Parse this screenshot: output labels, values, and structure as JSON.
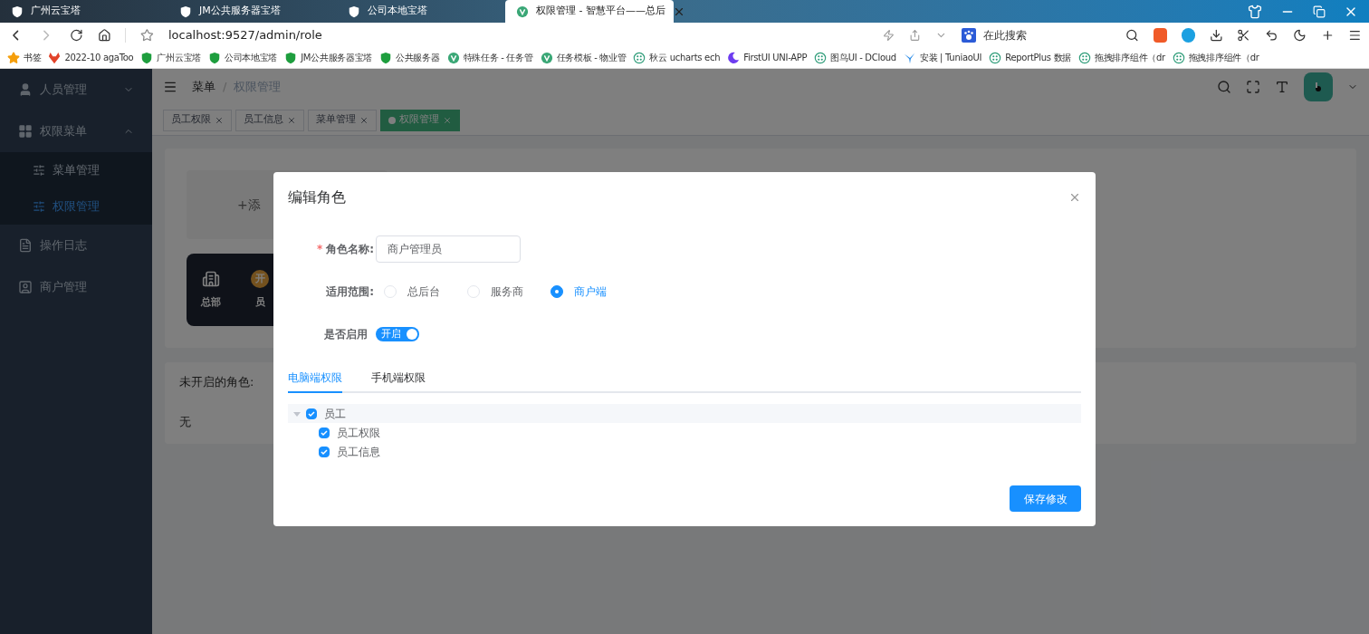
{
  "browser": {
    "tabs": [
      {
        "title": "广州云宝塔",
        "kind": "shield",
        "selected": false
      },
      {
        "title": "JM公共服务器宝塔",
        "kind": "shield",
        "selected": false
      },
      {
        "title": "公司本地宝塔",
        "kind": "shield",
        "selected": false
      },
      {
        "title": "权限管理 - 智慧平台——总后",
        "kind": "vue",
        "selected": true
      }
    ],
    "address": "localhost:9527/admin/role",
    "search_placeholder": "在此搜索",
    "bookmarks": [
      {
        "title": "书签",
        "kind": "star"
      },
      {
        "title": "2022-10 agaToo",
        "kind": "fox"
      },
      {
        "title": "广州云宝塔",
        "kind": "shield"
      },
      {
        "title": "公司本地宝塔",
        "kind": "shield"
      },
      {
        "title": "JM公共服务器宝塔",
        "kind": "shield"
      },
      {
        "title": "公共服务器",
        "kind": "shield"
      },
      {
        "title": "特殊任务 - 任务管",
        "kind": "vue"
      },
      {
        "title": "任务模板 - 物业管",
        "kind": "vue"
      },
      {
        "title": "秋云 ucharts ech",
        "kind": "globe"
      },
      {
        "title": "FirstUI UNI-APP",
        "kind": "moon"
      },
      {
        "title": "图鸟UI - DCloud",
        "kind": "globe"
      },
      {
        "title": "安装 | TuniaoUI",
        "kind": "bird"
      },
      {
        "title": "ReportPlus 数据",
        "kind": "globe"
      },
      {
        "title": "拖拽排序组件（dr",
        "kind": "globe"
      },
      {
        "title": "拖拽排序组件（dr",
        "kind": "globe"
      }
    ]
  },
  "sidebar": {
    "items": [
      {
        "label": "人员管理",
        "kind": "user",
        "expanded": false,
        "selected": false
      },
      {
        "label": "权限菜单",
        "kind": "grid",
        "expanded": true,
        "selected": false,
        "children": [
          {
            "label": "菜单管理",
            "selected": false
          },
          {
            "label": "权限管理",
            "selected": true
          }
        ]
      },
      {
        "label": "操作日志",
        "kind": "log",
        "selected": false
      },
      {
        "label": "商户管理",
        "kind": "merchant",
        "selected": false
      }
    ]
  },
  "header": {
    "breadcrumb": [
      "菜单",
      "权限管理"
    ],
    "separator": "/"
  },
  "tags": [
    {
      "label": "员工权限",
      "selected": false
    },
    {
      "label": "员工信息",
      "selected": false
    },
    {
      "label": "菜单管理",
      "selected": false
    },
    {
      "label": "权限管理",
      "selected": true
    }
  ],
  "content": {
    "add_card": "+添",
    "role_cards": [
      {
        "label": "总部",
        "kind": "building"
      },
      {
        "label": "员",
        "badge": "开",
        "kind": "badge"
      }
    ],
    "inactive": {
      "title": "未开启的角色:",
      "value": "无"
    }
  },
  "modal": {
    "title": "编辑角色",
    "name_field": {
      "label": "角色名称:",
      "required_mark": "*",
      "value": "商户管理员"
    },
    "scope": {
      "label": "适用范围:",
      "options": [
        {
          "label": "总后台",
          "selected": false
        },
        {
          "label": "服务商",
          "selected": false
        },
        {
          "label": "商户端",
          "selected": true
        }
      ]
    },
    "enabled": {
      "label": "是否启用",
      "on": true,
      "text": "开启"
    },
    "tabs": [
      {
        "label": "电脑端权限",
        "selected": true
      },
      {
        "label": "手机端权限",
        "selected": false
      }
    ],
    "tree": [
      {
        "label": "员工",
        "checked": true,
        "expanded": true,
        "children": [
          {
            "label": "员工权限",
            "checked": true
          },
          {
            "label": "员工信息",
            "checked": true
          }
        ]
      }
    ],
    "save_button": "保存修改"
  }
}
